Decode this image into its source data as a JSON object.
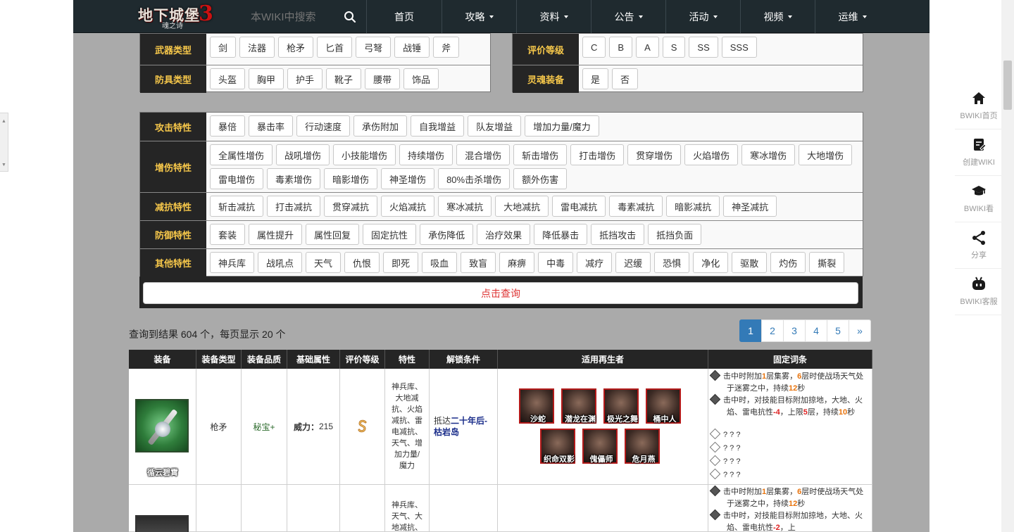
{
  "header": {
    "logo_title": "地下城堡",
    "logo_subtitle": "魂之诗",
    "logo_number": "3",
    "search_placeholder": "本WIKI中搜索",
    "nav": [
      {
        "label": "首页",
        "dropdown": false
      },
      {
        "label": "攻略",
        "dropdown": true
      },
      {
        "label": "资料",
        "dropdown": true
      },
      {
        "label": "公告",
        "dropdown": true
      },
      {
        "label": "活动",
        "dropdown": true
      },
      {
        "label": "视频",
        "dropdown": true
      },
      {
        "label": "运维",
        "dropdown": true
      }
    ]
  },
  "filters_top_left": [
    {
      "label": "武器类型",
      "options": [
        "剑",
        "法器",
        "枪矛",
        "匕首",
        "弓弩",
        "战锤",
        "斧"
      ]
    },
    {
      "label": "防具类型",
      "options": [
        "头盔",
        "胸甲",
        "护手",
        "靴子",
        "腰带",
        "饰品"
      ]
    }
  ],
  "filters_top_right": [
    {
      "label": "评价等级",
      "options": [
        "C",
        "B",
        "A",
        "S",
        "SS",
        "SSS"
      ]
    },
    {
      "label": "灵魂装备",
      "options": [
        "是",
        "否"
      ]
    }
  ],
  "filters_traits": [
    {
      "label": "攻击特性",
      "options": [
        "暴倍",
        "暴击率",
        "行动速度",
        "承伤附加",
        "自我增益",
        "队友增益",
        "增加力量/魔力"
      ]
    },
    {
      "label": "增伤特性",
      "options": [
        "全属性增伤",
        "战吼增伤",
        "小技能增伤",
        "持续增伤",
        "混合增伤",
        "斩击增伤",
        "打击增伤",
        "贯穿增伤",
        "火焰增伤",
        "寒冰增伤",
        "大地增伤",
        "雷电增伤",
        "毒素增伤",
        "暗影增伤",
        "神圣增伤",
        "80%击杀增伤",
        "额外伤害"
      ]
    },
    {
      "label": "减抗特性",
      "options": [
        "斩击减抗",
        "打击减抗",
        "贯穿减抗",
        "火焰减抗",
        "寒冰减抗",
        "大地减抗",
        "雷电减抗",
        "毒素减抗",
        "暗影减抗",
        "神圣减抗"
      ]
    },
    {
      "label": "防御特性",
      "options": [
        "套装",
        "属性提升",
        "属性回复",
        "固定抗性",
        "承伤降低",
        "治疗效果",
        "降低暴击",
        "抵挡攻击",
        "抵挡负面"
      ]
    },
    {
      "label": "其他特性",
      "options": [
        "神兵库",
        "战吼点",
        "天气",
        "仇恨",
        "即死",
        "吸血",
        "致盲",
        "麻痹",
        "中毒",
        "减疗",
        "迟缓",
        "恐惧",
        "净化",
        "驱散",
        "灼伤",
        "撕裂"
      ]
    }
  ],
  "query_button": "点击查询",
  "result_summary": "查询到结果 604 个，每页显示 20 个",
  "pagination": [
    "1",
    "2",
    "3",
    "4",
    "5",
    "»"
  ],
  "table": {
    "headers": [
      "装备",
      "装备类型",
      "装备品质",
      "基础属性",
      "评价等级",
      "特性",
      "解锁条件",
      "适用再生者",
      "固定词条"
    ],
    "rows": [
      {
        "name": "循云碧霄",
        "type": "枪矛",
        "quality": "秘宝+",
        "base_label": "威力：",
        "base_value": "215",
        "traits": "神兵库、大地减抗、火焰减抗、雷电减抗、天气、增加力量/魔力",
        "unlock_prefix": "抵达",
        "unlock_link": "二十年后-枯岩岛",
        "characters": [
          "沙蛇",
          "潜龙在渊",
          "极光之舞",
          "桶中人",
          "织命双影",
          "傀儡师",
          "危月燕"
        ],
        "affixes": [
          {
            "parts": [
              [
                "击中时附加",
                ""
              ],
              [
                "1",
                "o"
              ],
              [
                "层集雾，",
                ""
              ],
              [
                "6",
                "o"
              ],
              [
                "层时使战场天气处于迷雾之中，持续",
                ""
              ],
              [
                "12",
                "o"
              ],
              [
                "秒",
                ""
              ]
            ]
          },
          {
            "parts": [
              [
                "击中时，对技能目标附加掠地，大地、火焰、雷电抗性",
                ""
              ],
              [
                "-4",
                "r"
              ],
              [
                "，上限",
                ""
              ],
              [
                "5",
                "r"
              ],
              [
                "层，持续",
                ""
              ],
              [
                "10",
                "o"
              ],
              [
                "秒",
                ""
              ]
            ]
          },
          {
            "parts": [
              [
                "? ? ?",
                ""
              ]
            ]
          },
          {
            "parts": [
              [
                "? ? ?",
                ""
              ]
            ]
          },
          {
            "parts": [
              [
                "? ? ?",
                ""
              ]
            ]
          },
          {
            "parts": [
              [
                "? ? ?",
                ""
              ]
            ]
          }
        ]
      },
      {
        "traits": "神兵库、天气、大地减抗、",
        "affixes": [
          {
            "parts": [
              [
                "击中时附加",
                ""
              ],
              [
                "1",
                "o"
              ],
              [
                "层集雾，",
                ""
              ],
              [
                "6",
                "o"
              ],
              [
                "层时使战场天气处于迷雾之中，持续",
                ""
              ],
              [
                "12",
                "o"
              ],
              [
                "秒",
                ""
              ]
            ]
          },
          {
            "parts": [
              [
                "击中时，对技能目标附加掠地，大地、火焰、雷电抗性",
                ""
              ],
              [
                "-2",
                "r"
              ],
              [
                "，上",
                ""
              ]
            ]
          }
        ]
      }
    ]
  },
  "float_sidebar": [
    {
      "label": "BWIKI首页",
      "icon": "home-icon"
    },
    {
      "label": "创建WIKI",
      "icon": "create-wiki-icon"
    },
    {
      "label": "BWIKI看",
      "icon": "graduation-cap-icon"
    },
    {
      "label": "分享",
      "icon": "share-icon"
    },
    {
      "label": "BWIKI客服",
      "icon": "robot-icon"
    }
  ]
}
